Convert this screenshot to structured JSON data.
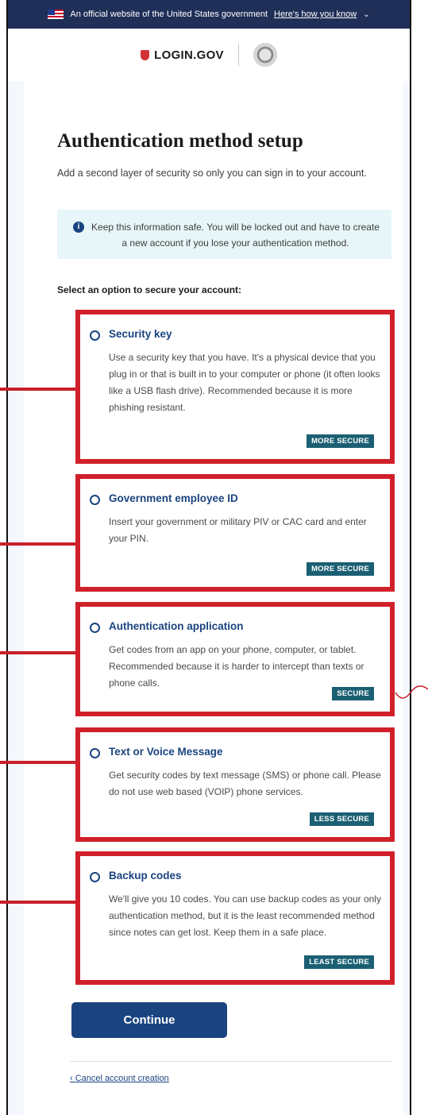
{
  "banner": {
    "text": "An official website of the United States government",
    "link": "Here's how you know"
  },
  "brand": {
    "logo_text": "LOGIN.GOV"
  },
  "page": {
    "title": "Authentication method setup",
    "intro": "Add a second layer of security so only you can sign in to your account.",
    "alert": "Keep this information safe. You will be locked out and have to create a new account if you lose your authentication method.",
    "select_label": "Select an option to secure your account:"
  },
  "options": [
    {
      "title": "Security key",
      "description": "Use a security key that you have. It's a physical device that you plug in or that is built in to your computer or phone (it often looks like a USB flash drive). Recommended because it is more phishing resistant.",
      "badge": "MORE SECURE"
    },
    {
      "title": "Government employee ID",
      "description": "Insert your government or military PIV or CAC card and enter your PIN.",
      "badge": "MORE SECURE"
    },
    {
      "title": "Authentication application",
      "description": "Get codes from an app on your phone, computer, or tablet. Recommended because it is harder to intercept than texts or phone calls.",
      "badge": "SECURE"
    },
    {
      "title": "Text or Voice Message",
      "description": "Get security codes by text message (SMS) or phone call. Please do not use web based (VOIP) phone services.",
      "badge": "LESS SECURE"
    },
    {
      "title": "Backup codes",
      "description": "We'll give you 10 codes. You can use backup codes as your only authentication method, but it is the least recommended method since notes can get lost. Keep them in a safe place.",
      "badge": "LEAST SECURE"
    }
  ],
  "actions": {
    "continue": "Continue",
    "cancel": "‹ Cancel account creation"
  },
  "colors": {
    "primary": "#1a4480",
    "highlight": "#d0202a",
    "badge": "#1b5f73",
    "banner": "#1f2f57"
  }
}
